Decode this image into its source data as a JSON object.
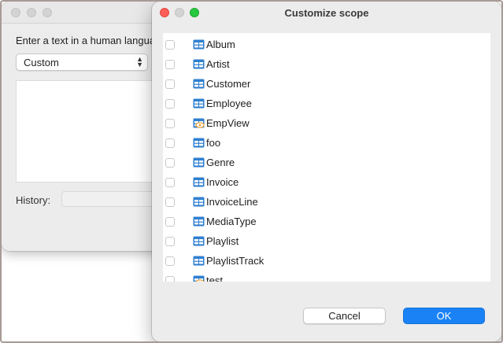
{
  "background_window": {
    "prompt": "Enter a text in a human languag",
    "select_value": "Custom",
    "history_label": "History:"
  },
  "dialog": {
    "title": "Customize scope",
    "items": [
      {
        "label": "Album",
        "icon": "table-icon",
        "checked": false
      },
      {
        "label": "Artist",
        "icon": "table-icon",
        "checked": false
      },
      {
        "label": "Customer",
        "icon": "table-icon",
        "checked": false
      },
      {
        "label": "Employee",
        "icon": "table-icon",
        "checked": false
      },
      {
        "label": "EmpView",
        "icon": "view-icon",
        "checked": false
      },
      {
        "label": "foo",
        "icon": "table-icon",
        "checked": false
      },
      {
        "label": "Genre",
        "icon": "table-icon",
        "checked": false
      },
      {
        "label": "Invoice",
        "icon": "table-icon",
        "checked": false
      },
      {
        "label": "InvoiceLine",
        "icon": "table-icon",
        "checked": false
      },
      {
        "label": "MediaType",
        "icon": "table-icon",
        "checked": false
      },
      {
        "label": "Playlist",
        "icon": "table-icon",
        "checked": false
      },
      {
        "label": "PlaylistTrack",
        "icon": "table-icon",
        "checked": false
      },
      {
        "label": "test",
        "icon": "view-icon",
        "checked": false
      }
    ],
    "cancel_label": "Cancel",
    "ok_label": "OK"
  },
  "colors": {
    "accent": "#1a82f5",
    "close": "#ff5f57",
    "zoom": "#28c840",
    "table_icon": "#2f7fd0",
    "view_badge": "#f0a030"
  }
}
